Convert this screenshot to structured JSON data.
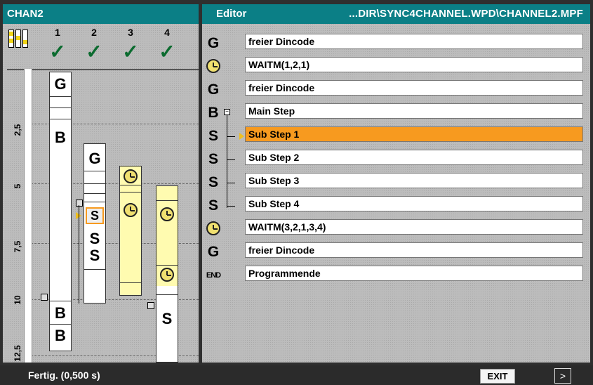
{
  "left_panel": {
    "title": "CHAN2",
    "channels": [
      "1",
      "2",
      "3",
      "4"
    ],
    "y_ticks": [
      "2,5",
      "5",
      "7,5",
      "10",
      "12,5"
    ],
    "symbols": {
      "g": "G",
      "b": "B",
      "s": "S"
    }
  },
  "editor": {
    "title": "Editor",
    "path": "...DIR\\SYNC4CHANNEL.WPD\\CHANNEL2.MPF",
    "rows": [
      {
        "icon": "G",
        "text": "freier Dincode"
      },
      {
        "icon": "clock",
        "text": "WAITM(1,2,1)"
      },
      {
        "icon": "G",
        "text": "freier Dincode"
      },
      {
        "icon": "B",
        "text": "Main Step"
      },
      {
        "icon": "S",
        "text": "Sub Step 1",
        "selected": true
      },
      {
        "icon": "S",
        "text": "Sub Step 2"
      },
      {
        "icon": "S",
        "text": "Sub Step 3"
      },
      {
        "icon": "S",
        "text": "Sub Step 4"
      },
      {
        "icon": "clock",
        "text": "WAITM(3,2,1,3,4)"
      },
      {
        "icon": "G",
        "text": "freier Dincode"
      },
      {
        "icon": "END",
        "text": "Programmende"
      }
    ]
  },
  "status_bar": {
    "message": "Fertig. (0,500 s)",
    "exit_label": "EXIT",
    "next_label": ">"
  },
  "colors": {
    "title_bar": "#0b7f86",
    "selected_row": "#f79a1f",
    "wait_column": "#fffbb0"
  }
}
